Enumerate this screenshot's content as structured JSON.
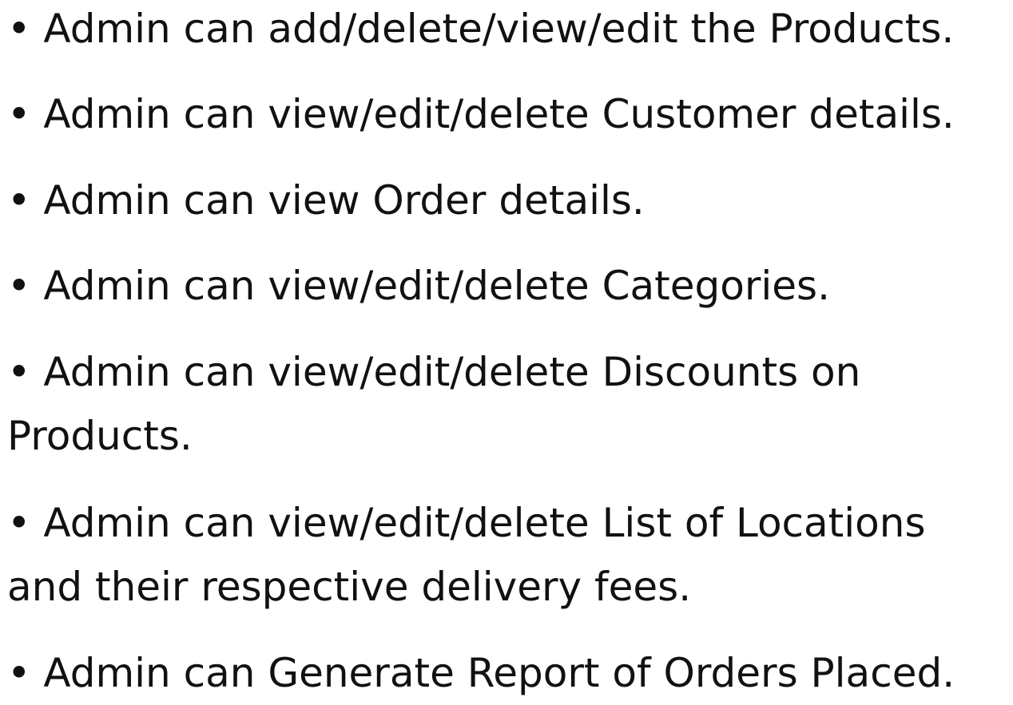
{
  "bullets": [
    {
      "lines": [
        "• Admin can add/delete/view/edit the Products."
      ]
    },
    {
      "lines": [
        "• Admin can view/edit/delete Customer details."
      ]
    },
    {
      "lines": [
        "• Admin can view Order details."
      ]
    },
    {
      "lines": [
        "• Admin can view/edit/delete Categories."
      ]
    },
    {
      "lines": [
        "• Admin can view/edit/delete Discounts on",
        "Products."
      ]
    },
    {
      "lines": [
        "• Admin can view/edit/delete List of Locations",
        "and their respective delivery fees."
      ]
    },
    {
      "lines": [
        "• Admin can Generate Report of Orders Placed."
      ]
    }
  ]
}
